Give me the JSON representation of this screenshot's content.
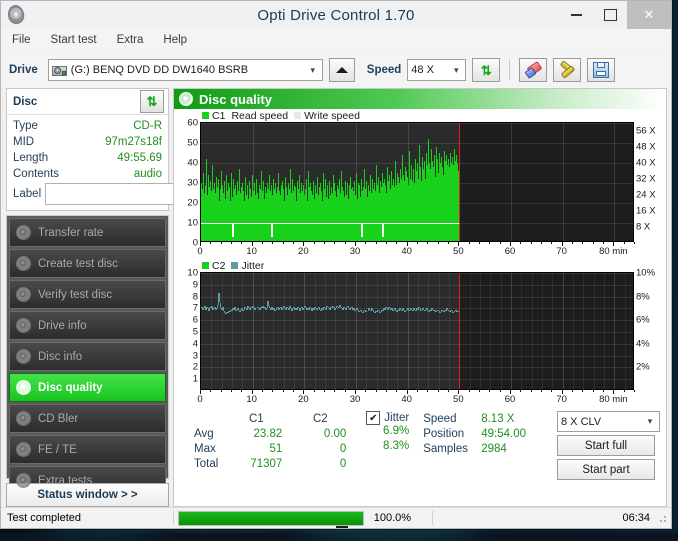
{
  "window": {
    "title": "Opti Drive Control 1.70",
    "app_icon": "disc-icon",
    "minimize": "–",
    "maximize": "□",
    "close": "✕"
  },
  "menubar": {
    "items": [
      "File",
      "Start test",
      "Extra",
      "Help"
    ]
  },
  "toolbar": {
    "drive_label": "Drive",
    "drive_value": "(G:)   BENQ DVD DD DW1640 BSRB",
    "eject_title": "eject",
    "speed_label": "Speed",
    "speed_value": "48 X",
    "refresh_icon": "refresh-icon",
    "eraser_icon": "eraser-icon",
    "tools_icon": "tools-icon",
    "save_icon": "save-icon"
  },
  "disc_panel": {
    "title": "Disc",
    "refresh_icon": "refresh-icon",
    "rows": [
      {
        "key": "Type",
        "value": "CD-R"
      },
      {
        "key": "MID",
        "value": "97m27s18f"
      },
      {
        "key": "Length",
        "value": "49:55.69"
      },
      {
        "key": "Contents",
        "value": "audio"
      }
    ],
    "label_key": "Label",
    "label_value": "",
    "label_placeholder": "",
    "cd_button_icon": "cd-icon"
  },
  "nav": {
    "items": [
      {
        "label": "Transfer rate",
        "selected": false
      },
      {
        "label": "Create test disc",
        "selected": false
      },
      {
        "label": "Verify test disc",
        "selected": false
      },
      {
        "label": "Drive info",
        "selected": false
      },
      {
        "label": "Disc info",
        "selected": false
      },
      {
        "label": "Disc quality",
        "selected": true
      },
      {
        "label": "CD Bler",
        "selected": false
      },
      {
        "label": "FE / TE",
        "selected": false
      },
      {
        "label": "Extra tests",
        "selected": false
      }
    ],
    "status_window": "Status window > >"
  },
  "quality_header": {
    "title": "Disc quality",
    "icon": "disc-quality-icon"
  },
  "stats": {
    "col_headers": [
      "C1",
      "C2"
    ],
    "rows": [
      {
        "label": "Avg",
        "c1": "23.82",
        "c2": "0.00",
        "jitter": "6.9%"
      },
      {
        "label": "Max",
        "c1": "51",
        "c2": "0",
        "jitter": "8.3%"
      },
      {
        "label": "Total",
        "c1": "71307",
        "c2": "0",
        "jitter": ""
      }
    ],
    "jitter_label": "Jitter",
    "jitter_checked": "✔",
    "speed_label": "Speed",
    "speed_value": "8.13 X",
    "position_label": "Position",
    "position_value": "49:54.00",
    "samples_label": "Samples",
    "samples_value": "2984",
    "write_mode": "8 X CLV",
    "start_full": "Start full",
    "start_part": "Start part"
  },
  "statusbar": {
    "message": "Test completed",
    "progress_label": "100.0%",
    "progress_percent": 100,
    "elapsed": "06:34"
  },
  "colors": {
    "accent_green": "#17d11b",
    "c1_green": "#17d11b",
    "jitter_teal": "#5e9ca5",
    "read_speed_white": "#ffffff",
    "marker_red": "#e02020",
    "value_text": "#1f8f1f",
    "key_text": "#22405c"
  },
  "chart_data": [
    {
      "type": "bar",
      "name": "C1 errors",
      "title": "Disc quality",
      "xlabel": "min",
      "ylabel": "C1",
      "xlim": [
        0,
        84
      ],
      "ylim": [
        0,
        60
      ],
      "yticks": [
        0,
        10,
        20,
        30,
        40,
        50,
        60
      ],
      "xticks": [
        0,
        10,
        20,
        30,
        40,
        50,
        60,
        70,
        80
      ],
      "xtick_labels": [
        "0",
        "10",
        "20",
        "30",
        "40",
        "50",
        "60",
        "70",
        "80 min"
      ],
      "right_axis": {
        "label": "speed",
        "ticks": [
          8,
          16,
          24,
          32,
          40,
          48,
          56
        ],
        "tick_labels": [
          "8 X",
          "16 X",
          "24 X",
          "32 X",
          "40 X",
          "48 X",
          "56 X"
        ],
        "ylim": [
          0,
          60
        ]
      },
      "legend": [
        {
          "label": "C1",
          "color": "#17d11b"
        },
        {
          "label": "Read speed",
          "color": "#ffffff"
        },
        {
          "label": "Write speed",
          "color": "#e8e8e8"
        }
      ],
      "grid": true,
      "data_end_min": 50,
      "marker_min": 50,
      "avg": 23.82,
      "max": 51,
      "total": 71307,
      "read_speed_const": 8.13,
      "values": [
        29,
        26,
        34,
        31,
        24,
        28,
        41,
        26,
        23,
        33,
        27,
        22,
        30,
        25,
        38,
        26,
        21,
        29,
        24,
        32,
        27,
        23,
        31,
        20,
        26,
        35,
        22,
        28,
        24,
        30,
        26,
        21,
        33,
        25,
        23,
        29,
        27,
        20,
        34,
        24,
        22,
        31,
        26,
        19,
        28,
        23,
        30,
        25,
        21,
        36,
        24,
        27,
        22,
        29,
        25,
        20,
        32,
        26,
        23,
        28,
        21,
        30,
        24,
        26,
        22,
        33,
        25,
        20,
        29,
        23,
        27,
        31,
        24,
        21,
        28,
        26,
        22,
        35,
        25,
        23,
        30,
        21,
        27,
        24,
        29,
        22,
        26,
        33,
        20,
        25,
        28,
        23,
        31,
        26,
        22,
        29,
        24,
        27,
        21,
        34,
        25,
        23,
        28,
        22,
        30,
        26,
        20,
        32,
        24,
        27,
        23,
        29,
        21,
        26,
        36,
        24,
        22,
        31,
        25,
        28,
        23,
        27,
        20,
        30,
        26,
        22,
        33,
        24,
        29,
        25,
        21,
        28,
        23,
        26,
        31,
        24,
        20,
        35,
        27,
        22,
        29,
        25,
        23,
        30,
        26,
        21,
        28,
        24,
        32,
        26,
        23,
        27,
        22,
        29,
        25,
        20,
        34,
        26,
        24,
        31,
        22,
        28,
        25,
        21,
        30,
        23,
        27,
        26,
        24,
        33,
        21,
        29,
        25,
        22,
        28,
        26,
        23,
        31,
        24,
        20,
        35,
        27,
        25,
        22,
        30,
        26,
        23,
        29,
        21,
        28,
        24,
        32,
        26,
        22,
        27,
        25,
        30,
        23,
        34,
        26,
        21,
        29,
        24,
        28,
        22,
        31,
        25,
        27,
        23,
        36,
        26,
        24,
        30,
        22,
        28,
        25,
        33,
        27,
        24,
        31,
        26,
        23,
        29,
        25,
        38,
        28,
        26,
        32,
        24,
        30,
        27,
        25,
        34,
        29,
        26,
        31,
        28,
        24,
        37,
        30,
        27,
        33,
        26,
        29,
        35,
        28,
        31,
        27,
        40,
        30,
        28,
        34,
        26,
        32,
        29,
        36,
        31,
        28,
        43,
        33,
        30,
        37,
        29,
        35,
        32,
        28,
        45,
        34,
        31,
        38,
        30,
        36,
        33,
        29,
        41,
        35,
        32,
        39,
        31,
        48,
        37,
        34,
        30,
        42,
        36,
        33,
        40,
        31,
        44,
        38,
        35,
        51,
        39,
        36,
        33,
        46,
        40,
        37,
        43,
        35,
        32,
        47,
        41,
        38,
        34,
        44,
        39,
        36,
        42,
        37,
        33,
        45,
        40,
        36,
        43,
        38,
        34,
        41,
        37,
        44,
        39,
        35,
        42,
        38,
        46,
        40,
        37,
        43,
        39,
        35,
        41
      ]
    },
    {
      "type": "line",
      "name": "C2 / Jitter",
      "xlabel": "min",
      "ylabel": "C2",
      "xlim": [
        0,
        84
      ],
      "ylim": [
        0,
        10
      ],
      "yticks": [
        0,
        1,
        2,
        3,
        4,
        5,
        6,
        7,
        8,
        9,
        10
      ],
      "xticks": [
        0,
        10,
        20,
        30,
        40,
        50,
        60,
        70,
        80
      ],
      "xtick_labels": [
        "0",
        "10",
        "20",
        "30",
        "40",
        "50",
        "60",
        "70",
        "80 min"
      ],
      "right_axis": {
        "label": "jitter",
        "ticks": [
          2,
          4,
          6,
          8,
          10
        ],
        "tick_labels": [
          "2%",
          "4%",
          "6%",
          "8%",
          "10%"
        ],
        "ylim": [
          0,
          10
        ]
      },
      "legend": [
        {
          "label": "C2",
          "color": "#17d11b"
        },
        {
          "label": "Jitter",
          "color": "#5e9ca5"
        }
      ],
      "grid": true,
      "data_end_min": 50,
      "marker_min": 50,
      "c2_avg": 0.0,
      "c2_max": 0,
      "c2_total": 0,
      "jitter_avg_pct": 6.9,
      "jitter_max_pct": 8.3,
      "jitter_values": [
        7.0,
        7.1,
        6.9,
        7.0,
        7.2,
        6.9,
        7.1,
        7.0,
        6.8,
        7.1,
        7.0,
        7.2,
        6.9,
        7.0,
        7.1,
        6.9,
        7.0,
        7.3,
        8.3,
        7.5,
        7.0,
        6.9,
        7.1,
        6.8,
        6.6,
        6.5,
        6.7,
        6.6,
        6.8,
        6.7,
        6.9,
        6.8,
        7.0,
        6.9,
        7.1,
        6.8,
        6.9,
        7.0,
        6.8,
        6.7,
        6.9,
        7.0,
        6.8,
        6.9,
        7.1,
        7.0,
        6.9,
        7.2,
        7.0,
        6.9,
        7.1,
        7.0,
        7.2,
        7.1,
        6.9,
        7.0,
        7.1,
        7.0,
        6.9,
        7.1,
        7.0,
        7.2,
        7.0,
        7.1,
        6.9,
        7.0,
        7.6,
        7.2,
        7.0,
        6.9,
        7.1,
        6.9,
        7.0,
        6.8,
        6.9,
        7.0,
        7.1,
        6.9,
        7.0,
        7.1,
        6.9,
        7.0,
        7.2,
        7.0,
        6.9,
        7.1,
        7.0,
        6.9,
        7.2,
        7.0,
        6.8,
        7.0,
        7.1,
        6.9,
        7.0,
        6.9,
        7.1,
        7.0,
        6.8,
        7.0,
        7.1,
        6.9,
        7.0,
        7.2,
        7.1,
        6.9,
        7.0,
        6.9,
        7.1,
        7.0,
        6.8,
        7.0,
        6.9,
        7.1,
        7.0,
        6.9,
        7.0,
        7.1,
        6.9,
        6.8,
        7.0,
        6.9,
        7.1,
        7.0,
        6.9,
        7.2,
        7.1,
        7.0,
        6.9,
        7.1,
        7.0,
        7.2,
        7.1,
        6.9,
        7.0,
        7.2,
        7.1,
        7.0,
        7.3,
        7.1,
        7.0,
        6.9,
        7.1,
        7.0,
        6.9,
        7.1,
        7.2,
        7.0,
        6.9,
        7.0,
        7.1,
        6.9,
        7.0,
        6.8,
        6.9,
        7.0,
        6.9,
        6.7,
        6.8,
        6.9,
        6.7,
        6.6,
        6.8,
        6.9,
        6.7,
        6.8,
        7.0,
        6.9,
        6.8,
        7.0,
        6.9,
        6.7,
        6.6,
        6.8,
        6.7,
        6.9,
        6.8,
        6.6,
        6.7,
        6.9,
        6.8,
        7.0,
        6.9,
        7.1,
        7.0,
        6.9,
        7.1,
        7.0,
        6.9,
        7.0,
        6.8,
        6.9,
        7.0,
        6.8,
        6.7,
        6.9,
        6.8,
        7.0,
        6.9,
        6.8,
        7.0,
        6.9,
        6.7,
        6.8,
        6.9,
        7.0,
        6.8,
        6.9,
        7.0,
        6.9,
        6.8,
        7.0,
        6.9,
        6.8,
        7.0,
        6.9,
        7.1,
        7.0,
        6.8,
        6.9,
        7.0,
        6.9,
        6.8,
        6.9,
        7.0,
        6.8,
        6.7,
        6.9,
        6.8,
        7.0,
        6.9,
        6.8,
        6.9,
        6.7,
        6.8,
        6.9,
        6.8,
        6.6,
        6.7,
        6.9,
        6.8,
        6.7,
        6.9,
        6.8,
        7.0,
        6.9,
        6.8,
        6.7,
        6.9,
        6.8,
        6.6,
        6.7,
        6.8,
        6.9,
        6.7,
        6.8
      ]
    }
  ]
}
